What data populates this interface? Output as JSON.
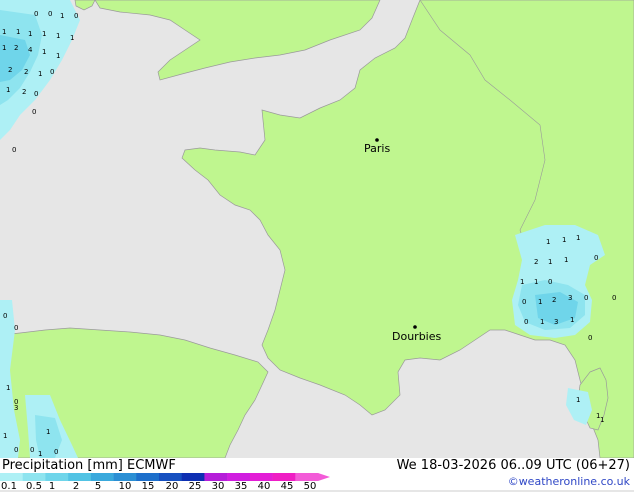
{
  "map": {
    "cities": [
      {
        "name": "Paris"
      },
      {
        "name": "Dourbies"
      }
    ],
    "precip_labels": [
      "0",
      "0",
      "1",
      "0",
      "1",
      "1",
      "1",
      "1",
      "1",
      "1",
      "1",
      "2",
      "4",
      "1",
      "1",
      "2",
      "2",
      "1",
      "0",
      "1",
      "2",
      "0",
      "0",
      "0",
      "0",
      "0",
      "1",
      "0",
      "1",
      "1",
      "0",
      "0",
      "3",
      "1",
      "0",
      "1",
      "1",
      "1",
      "2",
      "1",
      "1",
      "0",
      "1",
      "1",
      "0",
      "0",
      "1",
      "2",
      "3",
      "0",
      "0",
      "1",
      "3",
      "1",
      "0",
      "1",
      "1",
      "1",
      "0"
    ]
  },
  "footer": {
    "title": "Precipitation [mm]  ECMWF",
    "date": "We 18-03-2026 06..09 UTC (06+27)",
    "credit": "©weatheronline.co.uk"
  },
  "legend": {
    "ticks": [
      "0.1",
      "0.5",
      "1",
      "2",
      "5",
      "10",
      "15",
      "20",
      "25",
      "30",
      "35",
      "40",
      "45",
      "50"
    ],
    "colors": [
      "#aef0f5",
      "#8ee4ef",
      "#6fd5ea",
      "#52c3e4",
      "#3aa9dc",
      "#2b8fd4",
      "#1d6fcb",
      "#1650c0",
      "#0e2fb2",
      "#b51ed9",
      "#d01ee0",
      "#e31ed6",
      "#ef1ec4",
      "#f35bd8"
    ]
  }
}
